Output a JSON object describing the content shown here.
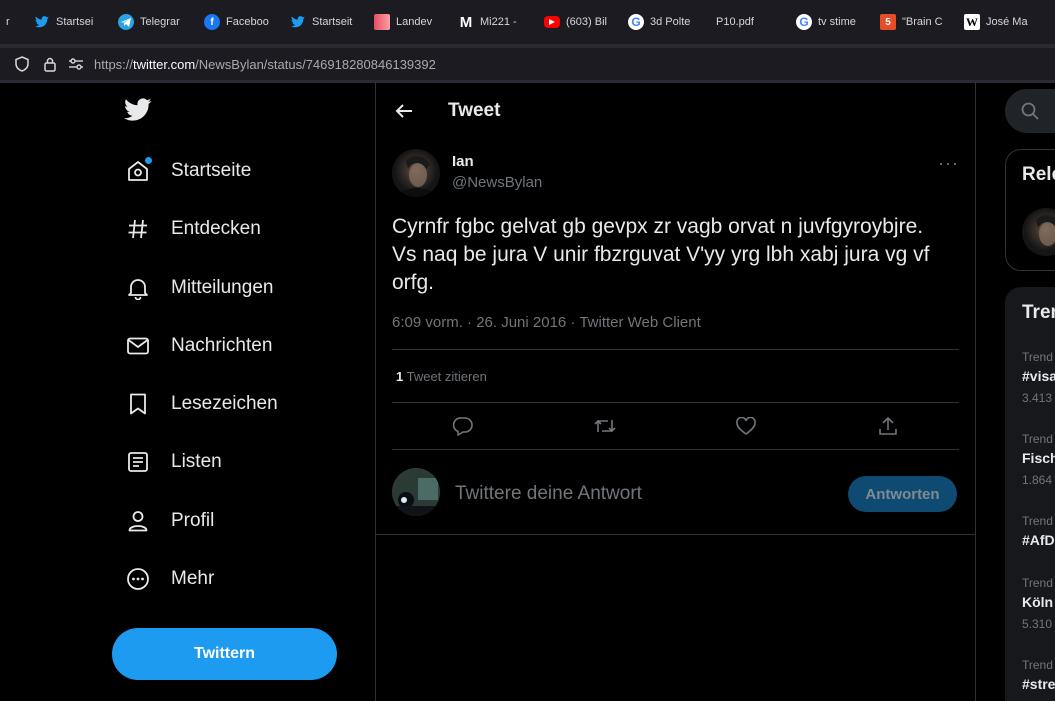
{
  "browser": {
    "bookmarks": [
      {
        "label": "r",
        "icon": "blank-icon",
        "color": "#1c1b22"
      },
      {
        "label": "Startsei",
        "icon": "twitter-icon",
        "color": "#1d9bf0"
      },
      {
        "label": "Telegrar",
        "icon": "telegram-icon",
        "color": "#2aa3df"
      },
      {
        "label": "Faceboo",
        "icon": "facebook-icon",
        "color": "#1877f2"
      },
      {
        "label": "Startseit",
        "icon": "twitter-icon",
        "color": "#1d9bf0"
      },
      {
        "label": "Landev",
        "icon": "page-icon",
        "color": "#e94d5f"
      },
      {
        "label": "Mi221 -",
        "icon": "m-icon",
        "color": "#333333"
      },
      {
        "label": "(603) Bil",
        "icon": "youtube-icon",
        "color": "#ff0000"
      },
      {
        "label": "3d Polte",
        "icon": "google-icon",
        "color": "#ffffff"
      },
      {
        "label": "P10.pdf",
        "icon": "blank-icon",
        "color": "#1c1b22"
      },
      {
        "label": "tv stime",
        "icon": "google-icon",
        "color": "#ffffff"
      },
      {
        "label": "\"Brain C",
        "icon": "html-icon",
        "color": "#e44d26"
      },
      {
        "label": "José Ma",
        "icon": "wikipedia-icon",
        "color": "#ffffff"
      }
    ],
    "url_prefix": "https://",
    "url_host": "twitter.com",
    "url_path": "/NewsBylan/status/746918280846139392"
  },
  "sidebar": {
    "items": [
      {
        "label": "Startseite",
        "icon": "home-icon"
      },
      {
        "label": "Entdecken",
        "icon": "hashtag-icon"
      },
      {
        "label": "Mitteilungen",
        "icon": "bell-icon"
      },
      {
        "label": "Nachrichten",
        "icon": "mail-icon"
      },
      {
        "label": "Lesezeichen",
        "icon": "bookmark-icon"
      },
      {
        "label": "Listen",
        "icon": "list-icon"
      },
      {
        "label": "Profil",
        "icon": "profile-icon"
      },
      {
        "label": "Mehr",
        "icon": "more-circle-icon"
      }
    ],
    "tweet_button": "Twittern"
  },
  "main": {
    "header_title": "Tweet",
    "author_name": "Ian",
    "author_handle": "@NewsBylan",
    "more": "···",
    "text": "Cyrnfr fgbc gelvat gb gevpx zr vagb orvat n juvfgyroybjre. Vs naq be jura V unir fbzrguvat V'yy yrg lbh xabj jura vg vf orfg.",
    "meta": "6:09 vorm. · 26. Juni 2016 · Twitter Web Client",
    "quote_count": "1",
    "quote_label": " Tweet zitieren",
    "reply_placeholder": "Twittere deine Antwort",
    "reply_button": "Antworten"
  },
  "right": {
    "relevant_title": "Rele",
    "trends_title": "Tren",
    "trends": [
      {
        "kicker": "Trend",
        "name": "#visa",
        "count": "3.413"
      },
      {
        "kicker": "Trend",
        "name": "Fisch",
        "count": "1.864"
      },
      {
        "kicker": "Trend",
        "name": "#AfD",
        "count": ""
      },
      {
        "kicker": "Trend",
        "name": "Köln",
        "count": "5.310"
      },
      {
        "kicker": "Trend",
        "name": "#stre",
        "count": ""
      }
    ]
  }
}
